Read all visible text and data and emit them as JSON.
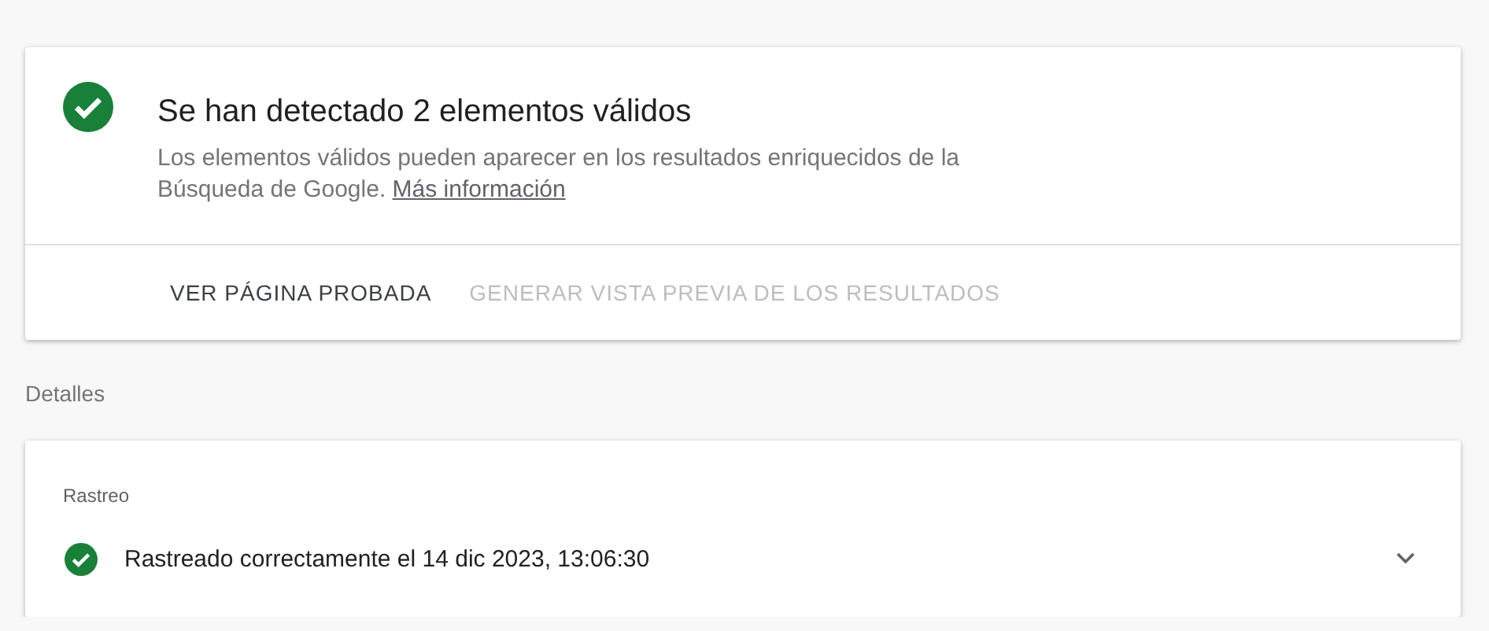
{
  "summary": {
    "title": "Se han detectado 2 elementos válidos",
    "description": "Los elementos válidos pueden aparecer en los resultados enriquecidos de la Búsqueda de Google.",
    "link": "Más información",
    "actions": [
      {
        "label": "VER PÁGINA PROBADA",
        "disabled": false
      },
      {
        "label": "GENERAR VISTA PREVIA DE LOS RESULTADOS",
        "disabled": true
      }
    ]
  },
  "details_heading": "Detalles",
  "details": {
    "section": "Rastreo",
    "rows": [
      {
        "text": "Rastreado correctamente el 14 dic 2023, 13:06:30",
        "expanded": false
      }
    ]
  }
}
